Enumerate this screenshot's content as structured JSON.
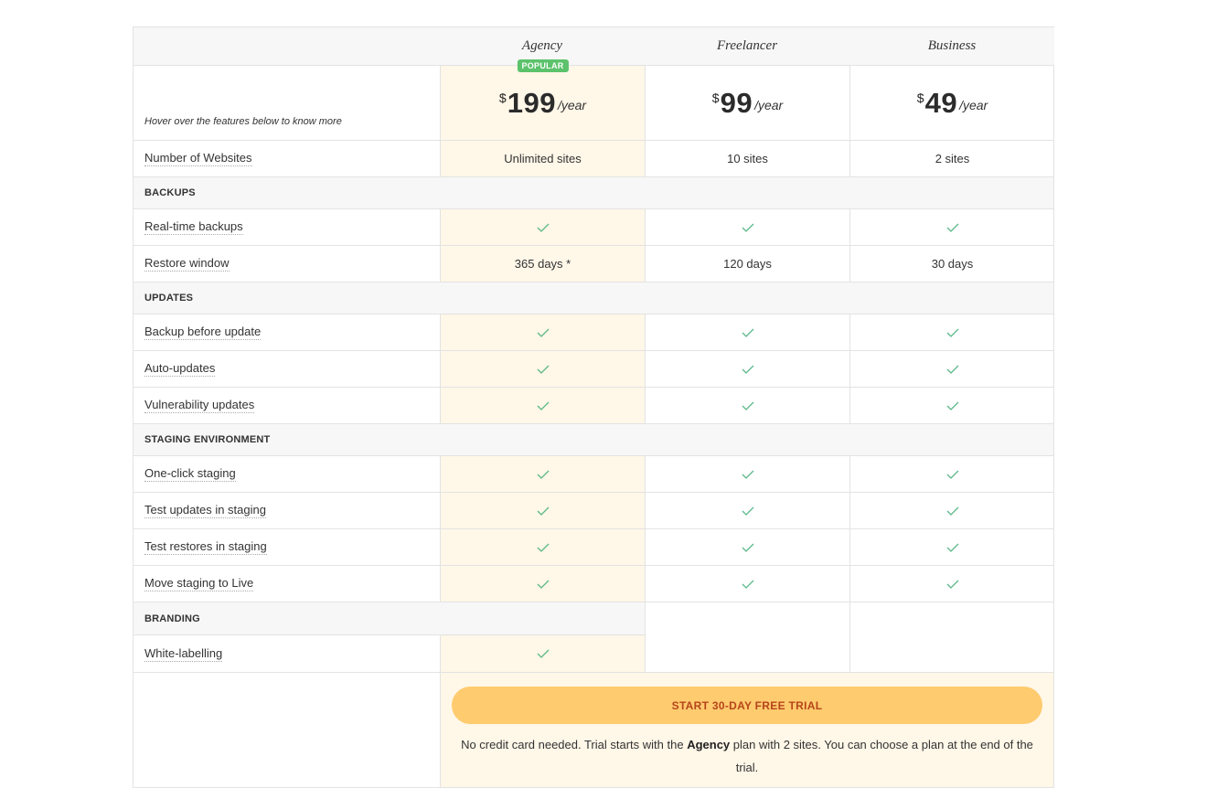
{
  "plans": [
    {
      "name": "Agency",
      "currency": "$",
      "price": "199",
      "period": "/year",
      "badge": "POPULAR"
    },
    {
      "name": "Freelancer",
      "currency": "$",
      "price": "99",
      "period": "/year"
    },
    {
      "name": "Business",
      "currency": "$",
      "price": "49",
      "period": "/year"
    }
  ],
  "hint": "Hover over the features below to know more",
  "websites": {
    "label": "Number of Websites",
    "values": [
      "Unlimited sites",
      "10 sites",
      "2 sites"
    ]
  },
  "sections": {
    "backups": {
      "title": "BACKUPS",
      "realtime": {
        "label": "Real-time backups"
      },
      "restore": {
        "label": "Restore window",
        "values": [
          "365 days *",
          "120 days",
          "30 days"
        ]
      }
    },
    "updates": {
      "title": "UPDATES",
      "items": [
        "Backup before update",
        "Auto-updates",
        "Vulnerability updates"
      ]
    },
    "staging": {
      "title": "STAGING ENVIRONMENT",
      "items": [
        "One-click staging",
        "Test updates in staging",
        "Test restores in staging",
        "Move staging to Live"
      ]
    },
    "branding": {
      "title": "BRANDING",
      "items": [
        "White-labelling"
      ]
    }
  },
  "cta": {
    "button": "START 30-DAY FREE TRIAL",
    "note_pre": "No credit card needed. Trial starts with the ",
    "note_plan": "Agency",
    "note_post": " plan with 2 sites. You can choose a plan at the end of the trial."
  },
  "colors": {
    "check": "#5cb88a",
    "highlight": "#fff7e8",
    "button": "#fecb6e",
    "button_text": "#b5451b",
    "badge": "#5cc26b"
  }
}
